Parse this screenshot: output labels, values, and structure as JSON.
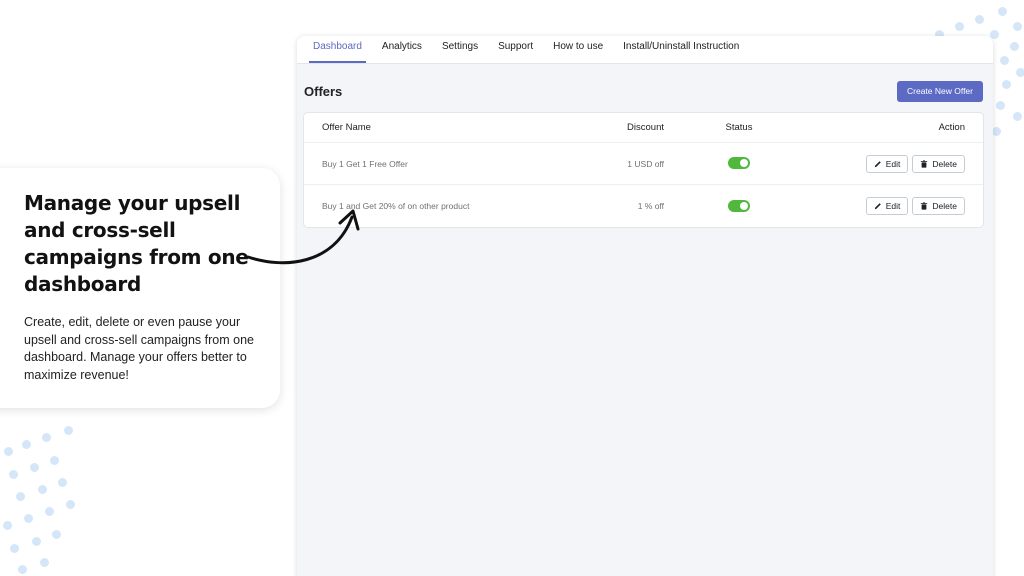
{
  "tabs": [
    {
      "label": "Dashboard",
      "active": true
    },
    {
      "label": "Analytics",
      "active": false
    },
    {
      "label": "Settings",
      "active": false
    },
    {
      "label": "Support",
      "active": false
    },
    {
      "label": "How to use",
      "active": false
    },
    {
      "label": "Install/Uninstall Instruction",
      "active": false
    }
  ],
  "page": {
    "title": "Offers",
    "create_button": "Create New Offer"
  },
  "table": {
    "headers": {
      "name": "Offer Name",
      "discount": "Discount",
      "status": "Status",
      "action": "Action"
    },
    "rows": [
      {
        "name": "Buy 1 Get 1 Free Offer",
        "discount": "1 USD off",
        "enabled": true,
        "edit": "Edit",
        "delete": "Delete"
      },
      {
        "name": "Buy 1 and Get 20% of on other product",
        "discount": "1 % off",
        "enabled": true,
        "edit": "Edit",
        "delete": "Delete"
      }
    ]
  },
  "promo": {
    "heading": "Manage your upsell and cross-sell campaigns from one dashboard",
    "body": "Create, edit, delete or even pause your upsell and cross-sell campaigns from one dashboard. Manage your offers better to maximize revenue!"
  },
  "colors": {
    "accent": "#5c6ac4",
    "toggle_on": "#50b83c",
    "dots": "#d4e6f8"
  },
  "icons": {
    "edit": "pencil-icon",
    "delete": "trash-icon",
    "arrow": "curved-arrow-icon"
  }
}
